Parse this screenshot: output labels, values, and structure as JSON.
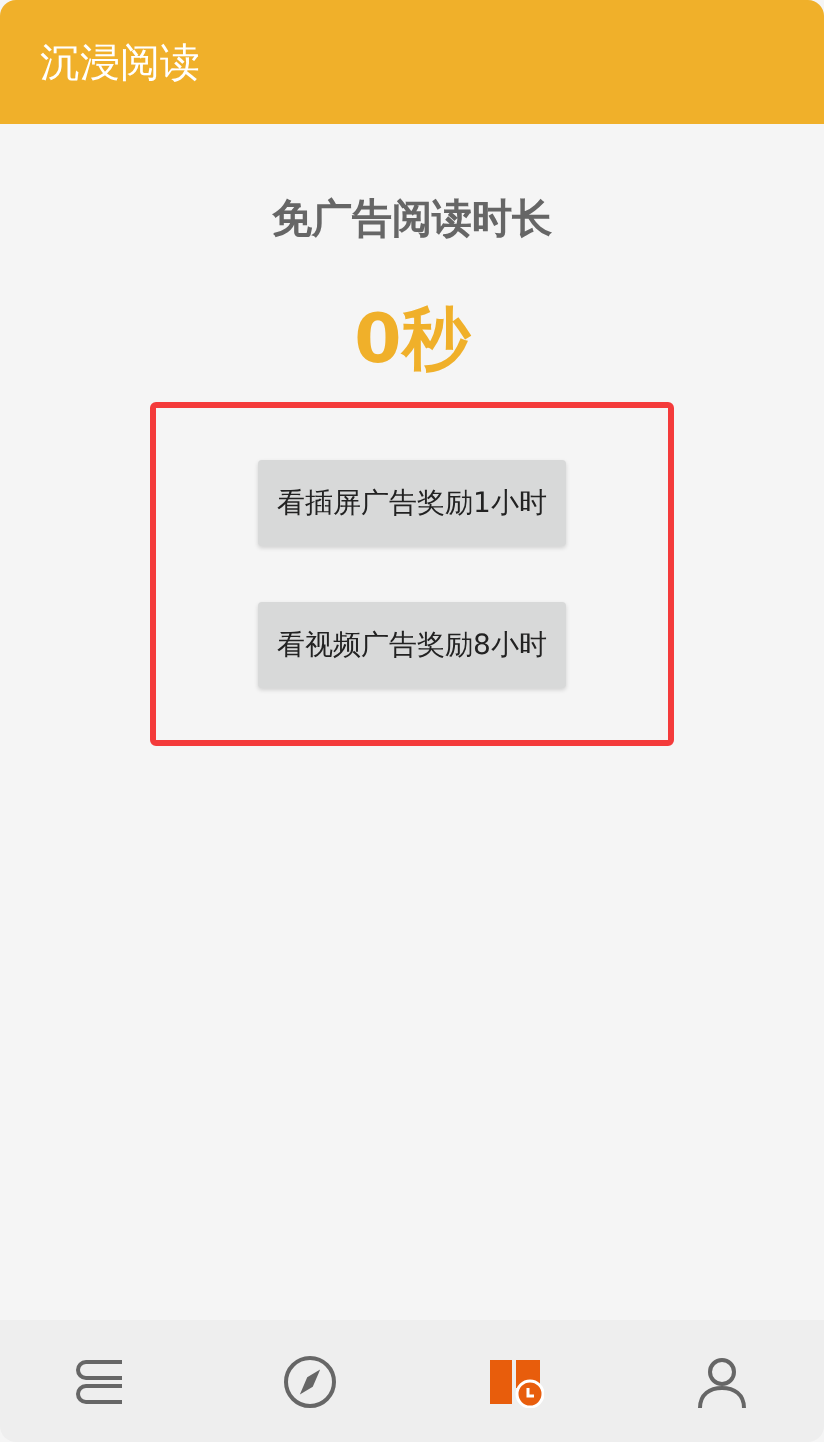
{
  "app_bar": {
    "title": "沉浸阅读"
  },
  "heading": "免广告阅读时长",
  "duration": "0秒",
  "reward_buttons": [
    {
      "label": "看插屏广告奖励1小时"
    },
    {
      "label": "看视频广告奖励8小时"
    }
  ],
  "bottom_nav": [
    {
      "kind": "books",
      "selected": false
    },
    {
      "kind": "compass",
      "selected": false
    },
    {
      "kind": "reading-time",
      "selected": true
    },
    {
      "kind": "profile",
      "selected": false
    }
  ]
}
